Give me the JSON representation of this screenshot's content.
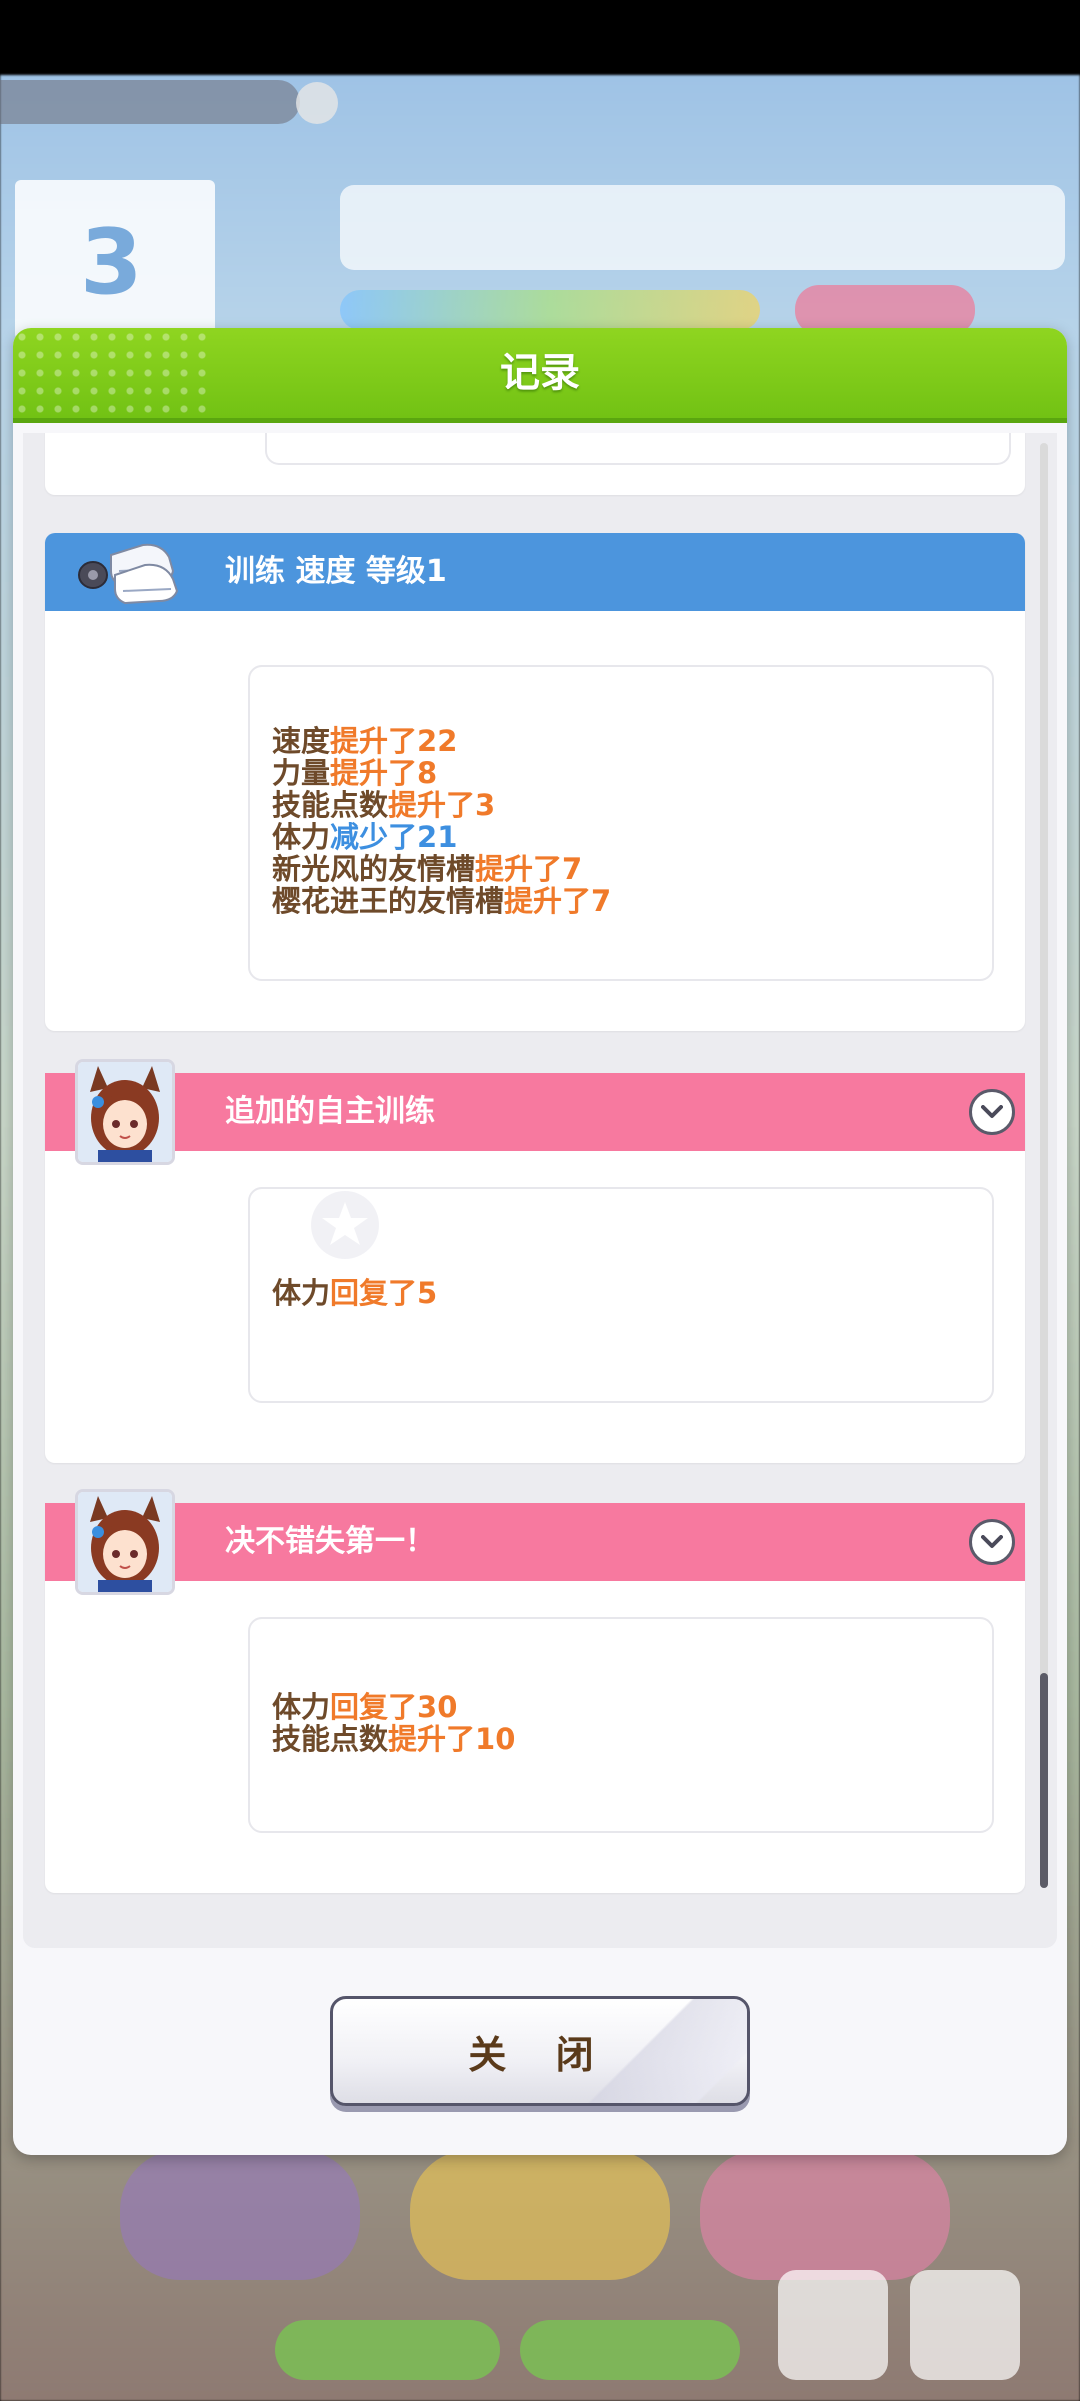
{
  "dialog": {
    "title": "记录",
    "close_label": "关 闭"
  },
  "entries": [
    {
      "type": "training",
      "title": "训练  速度  等级1",
      "icon": "training-shoes-icon",
      "color": "#4c95dd",
      "lines": [
        {
          "name": "速度",
          "effect": "提升了",
          "value": "22",
          "dir": "up"
        },
        {
          "name": "力量",
          "effect": "提升了",
          "value": "8",
          "dir": "up"
        },
        {
          "name": "技能点数",
          "effect": "提升了",
          "value": "3",
          "dir": "up"
        },
        {
          "name": "体力",
          "effect": "减少了",
          "value": "21",
          "dir": "down"
        },
        {
          "name": "新光风的友情槽",
          "effect": "提升了",
          "value": "7",
          "dir": "up"
        },
        {
          "name": "樱花进王的友情槽",
          "effect": "提升了",
          "value": "7",
          "dir": "up"
        }
      ]
    },
    {
      "type": "event",
      "title": "追加的自主训练",
      "icon": "character-avatar",
      "color": "#f7799f",
      "lines": [
        {
          "name": "体力",
          "effect": "回复了",
          "value": "5",
          "dir": "up"
        }
      ]
    },
    {
      "type": "event",
      "title": "决不错失第一！",
      "icon": "character-avatar",
      "color": "#f7799f",
      "lines": [
        {
          "name": "体力",
          "effect": "回复了",
          "value": "30",
          "dir": "up"
        },
        {
          "name": "技能点数",
          "effect": "提升了",
          "value": "10",
          "dir": "up"
        }
      ]
    }
  ],
  "background": {
    "turn_number": "3"
  },
  "colors": {
    "header_green": "#7ccb19",
    "stat_name": "#6e4a2a",
    "stat_up": "#f07a2a",
    "stat_down": "#3d8fe0"
  }
}
